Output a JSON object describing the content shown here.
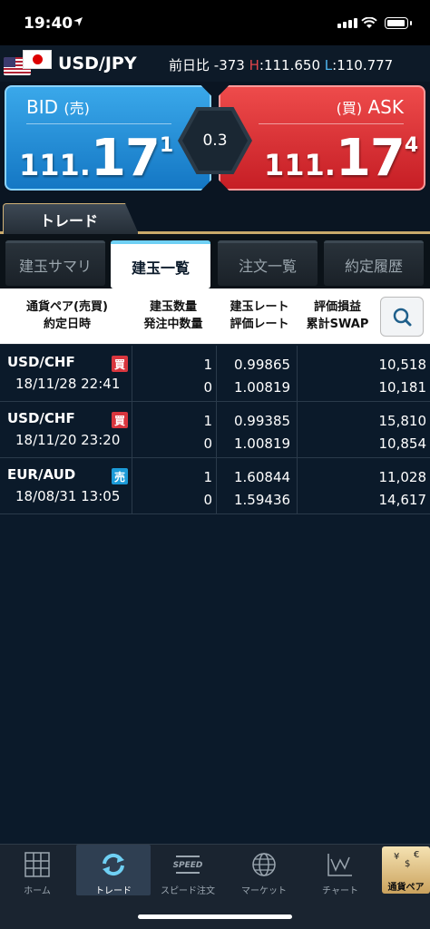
{
  "status_bar": {
    "time": "19:40"
  },
  "quote": {
    "pair": "USD/JPY",
    "change_label": "前日比",
    "change_value": "-373",
    "high_label": "H",
    "high_value": ":111.650",
    "low_label": "L",
    "low_value": ":110.777"
  },
  "bid": {
    "label": "BID",
    "label_sub": "(売)",
    "price_a": "111.",
    "price_b": "17",
    "price_c": "1"
  },
  "ask": {
    "label": "ASK",
    "label_sub": "(買)",
    "price_a": "111.",
    "price_b": "17",
    "price_c": "4"
  },
  "spread": "0.3",
  "trade_tab": "トレード",
  "subtabs": [
    "建玉サマリ",
    "建玉一覧",
    "注文一覧",
    "約定履歴"
  ],
  "table_header": {
    "col1_line1": "通貨ペア(売買)",
    "col1_line2": "約定日時",
    "col2_line1": "建玉数量",
    "col2_line2": "発注中数量",
    "col3_line1": "建玉レート",
    "col3_line2": "評価レート",
    "col4_line1": "評価損益",
    "col4_line2": "累計SWAP"
  },
  "rows": [
    {
      "symbol": "USD/CHF",
      "side": "買",
      "side_color": "#d9363e",
      "datetime": "18/11/28 22:41",
      "qty": "1",
      "pending": "0",
      "open_rate": "0.99865",
      "eval_rate": "1.00819",
      "pl": "10,518",
      "swap": "10,181"
    },
    {
      "symbol": "USD/CHF",
      "side": "買",
      "side_color": "#d9363e",
      "datetime": "18/11/20 23:20",
      "qty": "1",
      "pending": "0",
      "open_rate": "0.99385",
      "eval_rate": "1.00819",
      "pl": "15,810",
      "swap": "10,854"
    },
    {
      "symbol": "EUR/AUD",
      "side": "売",
      "side_color": "#1c9bd8",
      "datetime": "18/08/31 13:05",
      "qty": "1",
      "pending": "0",
      "open_rate": "1.60844",
      "eval_rate": "1.59436",
      "pl": "11,028",
      "swap": "14,617"
    }
  ],
  "nav": [
    {
      "label": "ホーム",
      "icon": "grid-icon"
    },
    {
      "label": "トレード",
      "icon": "refresh-icon"
    },
    {
      "label": "スピード注文",
      "icon": "speed-icon"
    },
    {
      "label": "マーケット",
      "icon": "globe-icon"
    },
    {
      "label": "チャート",
      "icon": "chart-icon"
    },
    {
      "label": "通貨ペア",
      "icon": "currency-icon"
    }
  ],
  "nav_speed_text": "SPEED",
  "colors": {
    "bid": "#1f8ad6",
    "ask": "#e23339",
    "active_tab_accent": "#6fd0f4",
    "trade_tab_border": "#c9a96a"
  }
}
